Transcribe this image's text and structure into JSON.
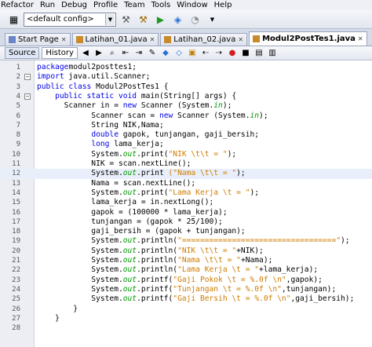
{
  "menu": [
    "Refactor",
    "Run",
    "Debug",
    "Profile",
    "Team",
    "Tools",
    "Window",
    "Help"
  ],
  "toolbar": {
    "config": "<default config>"
  },
  "tabs": [
    {
      "label": "Start Page",
      "active": false
    },
    {
      "label": "Latihan_01.java",
      "active": false
    },
    {
      "label": "Latihan_02.java",
      "active": false
    },
    {
      "label": "Modul2PostTes1.java",
      "active": true
    }
  ],
  "editor_toolbar": {
    "source": "Source",
    "history": "History"
  },
  "lines": [
    {
      "n": "1",
      "t": [
        [
          "kw",
          "package"
        ],
        [
          "",
          "modul2posttes1;"
        ]
      ]
    },
    {
      "n": "2",
      "fold": "-",
      "t": [
        [
          "kw",
          "import"
        ],
        [
          "",
          " java.util.Scanner;"
        ]
      ]
    },
    {
      "n": "3",
      "t": [
        [
          "kw",
          "public class"
        ],
        [
          "",
          " Modul2PostTes1 {"
        ]
      ]
    },
    {
      "n": "4",
      "fold": "-",
      "t": [
        [
          "",
          "    "
        ],
        [
          "kw",
          "public static void"
        ],
        [
          "",
          " main(String[] args) {"
        ]
      ]
    },
    {
      "n": "5",
      "t": [
        [
          "",
          "      Scanner in = "
        ],
        [
          "kw",
          "new"
        ],
        [
          "",
          " Scanner (System."
        ],
        [
          "out",
          "in"
        ],
        [
          "",
          ");"
        ]
      ]
    },
    {
      "n": "6",
      "t": [
        [
          "",
          "            Scanner scan = "
        ],
        [
          "kw",
          "new"
        ],
        [
          "",
          " Scanner (System."
        ],
        [
          "out",
          "in"
        ],
        [
          "",
          ");"
        ]
      ]
    },
    {
      "n": "7",
      "t": [
        [
          "",
          "            String NIK,Nama;"
        ]
      ]
    },
    {
      "n": "8",
      "t": [
        [
          "",
          "            "
        ],
        [
          "kw",
          "double"
        ],
        [
          "",
          " gapok, tunjangan, gaji_bersih;"
        ]
      ]
    },
    {
      "n": "9",
      "t": [
        [
          "",
          "            "
        ],
        [
          "kw",
          "long"
        ],
        [
          "",
          " lama_kerja;"
        ]
      ]
    },
    {
      "n": "10",
      "t": [
        [
          "",
          "            System."
        ],
        [
          "out",
          "out"
        ],
        [
          "",
          ".print("
        ],
        [
          "str",
          "\"NIK \\t\\t = \""
        ],
        [
          "",
          ");"
        ]
      ]
    },
    {
      "n": "11",
      "t": [
        [
          "",
          "            NIK = scan.nextLine();"
        ]
      ]
    },
    {
      "n": "12",
      "hl": true,
      "t": [
        [
          "",
          "            System."
        ],
        [
          "out",
          "out"
        ],
        [
          "",
          ".print "
        ],
        [
          "str",
          "(\"Nama \\t\\t = \""
        ],
        [
          "",
          ");"
        ]
      ]
    },
    {
      "n": "13",
      "t": [
        [
          "",
          "            Nama = scan.nextLine();"
        ]
      ]
    },
    {
      "n": "14",
      "t": [
        [
          "",
          "            System."
        ],
        [
          "out",
          "out"
        ],
        [
          "",
          ".print("
        ],
        [
          "str",
          "\"Lama Kerja \\t = \""
        ],
        [
          "",
          ");"
        ]
      ]
    },
    {
      "n": "15",
      "t": [
        [
          "",
          "            lama_kerja = in.nextLong();"
        ]
      ]
    },
    {
      "n": "16",
      "t": [
        [
          "",
          "            gapok = (100000 * lama_kerja);"
        ]
      ]
    },
    {
      "n": "17",
      "t": [
        [
          "",
          "            tunjangan = (gapok * 25/100);"
        ]
      ]
    },
    {
      "n": "18",
      "t": [
        [
          "",
          "            gaji_bersih = (gapok + tunjangan);"
        ]
      ]
    },
    {
      "n": "19",
      "t": [
        [
          "",
          "            System."
        ],
        [
          "out",
          "out"
        ],
        [
          "",
          ".println("
        ],
        [
          "str",
          "\"==================================\""
        ],
        [
          "",
          ");"
        ]
      ]
    },
    {
      "n": "20",
      "t": [
        [
          "",
          "            System."
        ],
        [
          "out",
          "out"
        ],
        [
          "",
          ".println("
        ],
        [
          "str",
          "\"NIK \\t\\t = \""
        ],
        [
          "",
          "+NIK);"
        ]
      ]
    },
    {
      "n": "21",
      "t": [
        [
          "",
          "            System."
        ],
        [
          "out",
          "out"
        ],
        [
          "",
          ".println("
        ],
        [
          "str",
          "\"Nama \\t\\t = \""
        ],
        [
          "",
          "+Nama);"
        ]
      ]
    },
    {
      "n": "22",
      "t": [
        [
          "",
          "            System."
        ],
        [
          "out",
          "out"
        ],
        [
          "",
          ".println("
        ],
        [
          "str",
          "\"Lama Kerja \\t = \""
        ],
        [
          "",
          "+lama_kerja);"
        ]
      ]
    },
    {
      "n": "23",
      "t": [
        [
          "",
          "            System."
        ],
        [
          "out",
          "out"
        ],
        [
          "",
          ".printf("
        ],
        [
          "str",
          "\"Gaji Pokok \\t = %.0f \\n\""
        ],
        [
          "",
          ",gapok);"
        ]
      ]
    },
    {
      "n": "24",
      "t": [
        [
          "",
          "            System."
        ],
        [
          "out",
          "out"
        ],
        [
          "",
          ".printf("
        ],
        [
          "str",
          "\"Tunjangan \\t = %.0f \\n\""
        ],
        [
          "",
          ",tunjangan);"
        ]
      ]
    },
    {
      "n": "25",
      "t": [
        [
          "",
          "            System."
        ],
        [
          "out",
          "out"
        ],
        [
          "",
          ".printf("
        ],
        [
          "str",
          "\"Gaji Bersih \\t = %.0f \\n\""
        ],
        [
          "",
          ",gaji_bersih);"
        ]
      ]
    },
    {
      "n": "26",
      "t": [
        [
          "",
          "        }"
        ]
      ]
    },
    {
      "n": "27",
      "t": [
        [
          "",
          "    }"
        ]
      ]
    },
    {
      "n": "28",
      "t": [
        [
          "",
          ""
        ]
      ]
    }
  ]
}
